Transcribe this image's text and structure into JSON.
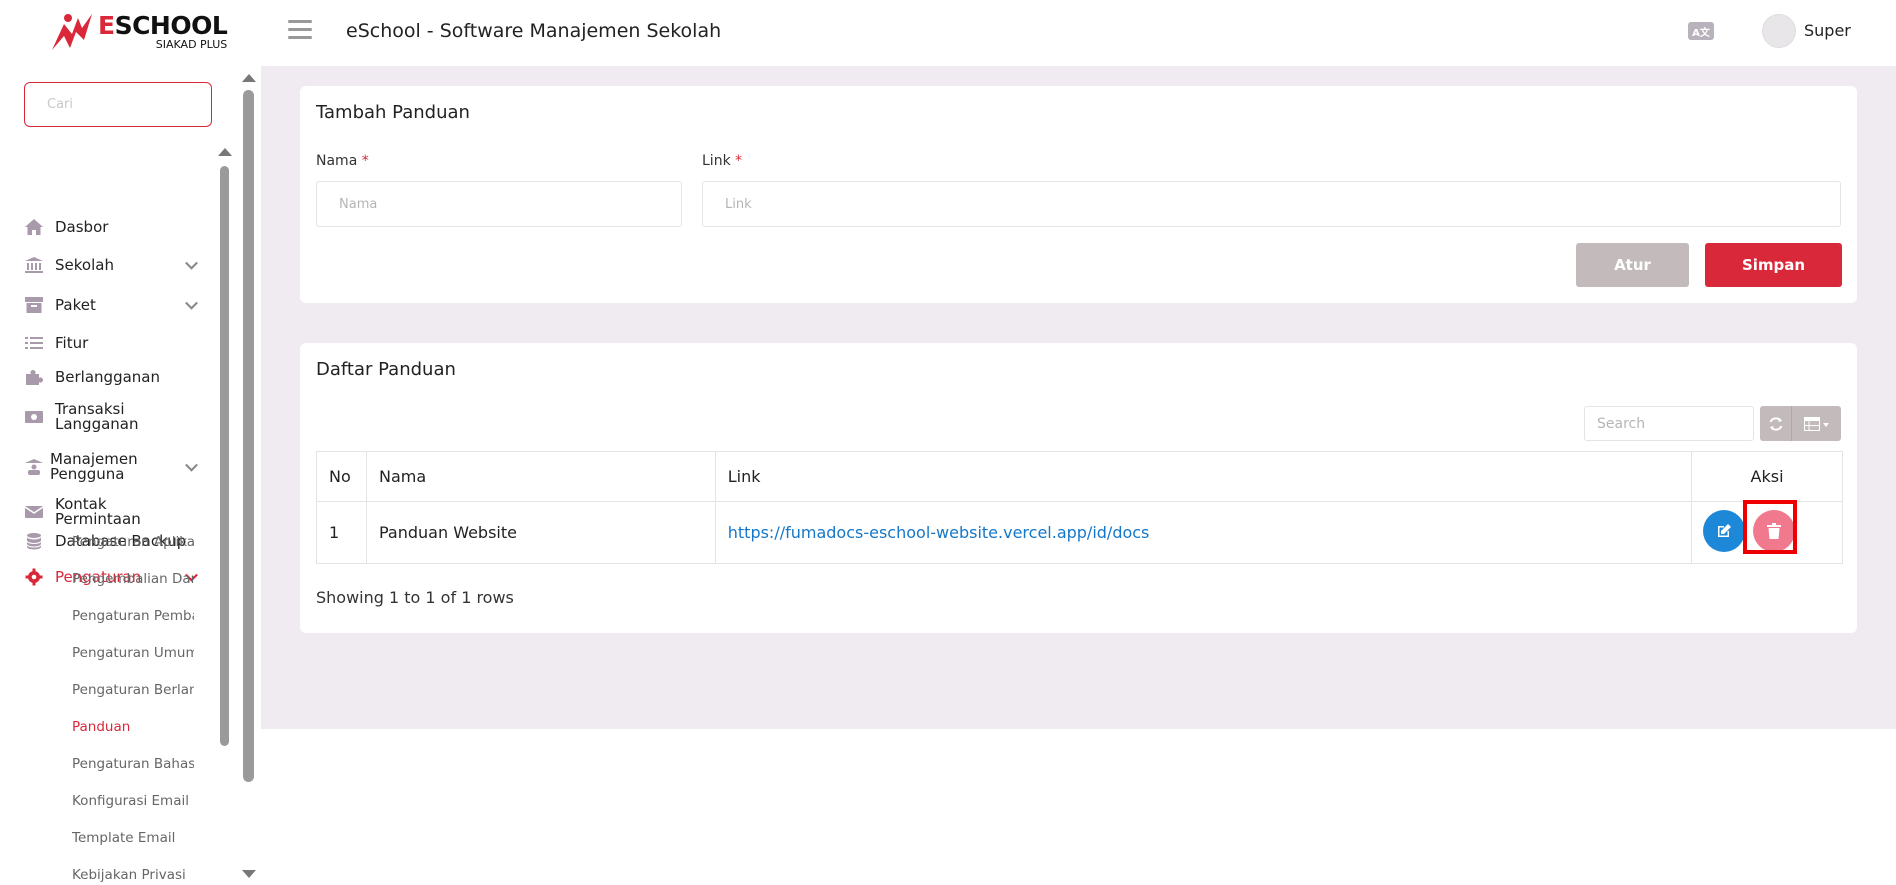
{
  "header": {
    "logo_title_first": "E",
    "logo_title_rest": "SCHOOL",
    "logo_sub": "SIAKAD PLUS",
    "app_title": "eSchool - Software Manajemen Sekolah",
    "lang_icon_text": "A文",
    "username": "Super"
  },
  "sidebar": {
    "search_placeholder": "Cari",
    "items": [
      {
        "label": "Dasbor",
        "icon": "home-icon"
      },
      {
        "label": "Sekolah",
        "icon": "bank-icon"
      },
      {
        "label": "Paket",
        "icon": "archive-icon"
      },
      {
        "label": "Fitur",
        "icon": "list-icon"
      },
      {
        "label": "Berlangganan",
        "icon": "puzzle-icon"
      },
      {
        "label": "Transaksi Langganan",
        "icon": "money-icon"
      },
      {
        "label": "Manajemen Pengguna",
        "icon": "users-icon"
      },
      {
        "label": "Kontak Permintaan",
        "icon": "envelope-icon"
      },
      {
        "label": "Database Backup",
        "icon": "database-icon"
      },
      {
        "label": "Pengaturan",
        "icon": "gear-icon"
      }
    ],
    "sub_items": [
      "Pengaturan Aplikasi",
      "Pengembalian Dana",
      "Pengaturan Pembayaran",
      "Pengaturan Umum",
      "Pengaturan Berlangganan",
      "Panduan",
      "Pengaturan Bahasa",
      "Konfigurasi Email",
      "Template Email",
      "Kebijakan Privasi"
    ]
  },
  "form": {
    "title": "Tambah Panduan",
    "name_label": "Nama",
    "name_placeholder": "Nama",
    "link_label": "Link",
    "link_placeholder": "Link",
    "required_mark": "*",
    "reset_label": "Atur",
    "save_label": "Simpan"
  },
  "list": {
    "title": "Daftar Panduan",
    "search_placeholder": "Search",
    "columns": [
      "No",
      "Nama",
      "Link",
      "Aksi"
    ],
    "rows": [
      {
        "no": "1",
        "nama": "Panduan Website",
        "link": "https://fumadocs-eschool-website.vercel.app/id/docs"
      }
    ],
    "footer": "Showing 1 to 1 of 1 rows"
  },
  "colors": {
    "accent": "#d9283a",
    "content_bg": "#f0ebf0",
    "link": "#1577c9",
    "edit_button": "#1e88d8",
    "delete_button": "#f0798e",
    "highlight": "#ee0000"
  }
}
